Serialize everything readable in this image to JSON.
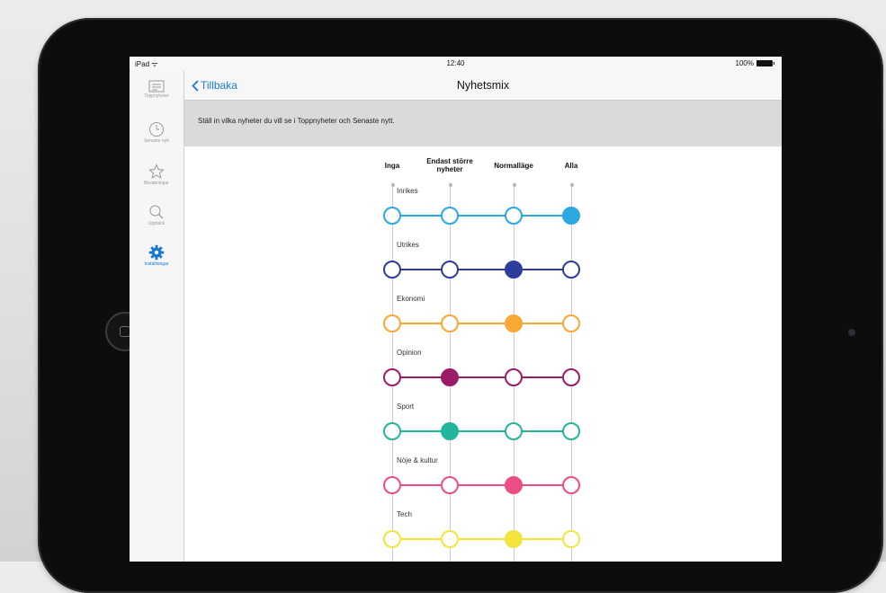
{
  "status_bar": {
    "device": "iPad",
    "time": "12:40",
    "battery": "100%"
  },
  "sidebar": {
    "items": [
      {
        "label": "Toppnyheter",
        "icon": "newspaper-icon",
        "active": false
      },
      {
        "label": "Senaste nytt",
        "icon": "clock-icon",
        "active": false
      },
      {
        "label": "Bevakningar",
        "icon": "star-icon",
        "active": false
      },
      {
        "label": "Upptäck",
        "icon": "search-icon",
        "active": false
      },
      {
        "label": "Inställningar",
        "icon": "gear-icon",
        "active": true
      }
    ]
  },
  "nav": {
    "back_label": "Tillbaka",
    "title": "Nyhetsmix"
  },
  "info": {
    "text": "Ställ in vilka nyheter du vill se i Toppnyheter och Senaste nytt."
  },
  "levels": [
    "Inga",
    "Endast större nyheter",
    "Normalläge",
    "Alla"
  ],
  "categories": [
    {
      "name": "Inrikes",
      "color": "#2aa8e0",
      "selected": 3
    },
    {
      "name": "Utrikes",
      "color": "#2e3c9c",
      "selected": 2
    },
    {
      "name": "Ekonomi",
      "color": "#f7a933",
      "selected": 2
    },
    {
      "name": "Opinion",
      "color": "#9b1b69",
      "selected": 1
    },
    {
      "name": "Sport",
      "color": "#22b59b",
      "selected": 1
    },
    {
      "name": "Nöje & kultur",
      "color": "#ec4d85",
      "selected": 2
    },
    {
      "name": "Tech",
      "color": "#f2e33d",
      "selected": 2
    }
  ]
}
